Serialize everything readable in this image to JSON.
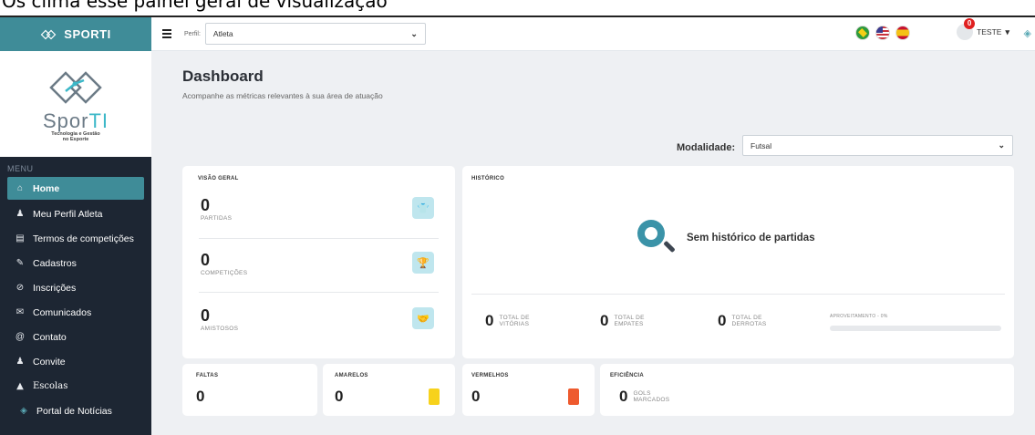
{
  "caption": "Os clima esse painel geral de visualização",
  "sidebar": {
    "brand": "SPORTI",
    "logo_name_a": "Spor",
    "logo_name_b": "TI",
    "logo_tagline_1": "Tecnologia e Gestão",
    "logo_tagline_2": "no Esporte",
    "menu_label": "MENU",
    "items": [
      {
        "label": "Home",
        "icon": "home-icon",
        "active": true
      },
      {
        "label": "Meu Perfil Atleta",
        "icon": "user-icon"
      },
      {
        "label": "Termos de competições",
        "icon": "document-icon"
      },
      {
        "label": "Cadastros",
        "icon": "edit-icon"
      },
      {
        "label": "Inscrições",
        "icon": "check-circle-icon"
      },
      {
        "label": "Comunicados",
        "icon": "envelope-icon"
      },
      {
        "label": "Contato",
        "icon": "at-icon"
      },
      {
        "label": "Convite",
        "icon": "users-icon"
      },
      {
        "label": "Escolas",
        "icon": "graduation-cap-icon"
      },
      {
        "label": "Portal de Notícias",
        "icon": "sporti-logo-icon"
      }
    ]
  },
  "topbar": {
    "perfil_label": "Perfil:",
    "perfil_value": "Atleta",
    "flags": [
      "brazil-flag-icon",
      "usa-flag-icon",
      "spain-flag-icon"
    ],
    "notification_count": "0",
    "user_name": "TESTE"
  },
  "header": {
    "title": "Dashboard",
    "subtitle": "Acompanhe as métricas relevantes à sua área de atuação",
    "modalidade_label": "Modalidade:",
    "modalidade_value": "Futsal"
  },
  "overview": {
    "title": "VISÃO GERAL",
    "metrics": [
      {
        "value": "0",
        "label": "PARTIDAS",
        "icon": "shirt-icon"
      },
      {
        "value": "0",
        "label": "COMPETIÇÕES",
        "icon": "trophy-icon"
      },
      {
        "value": "0",
        "label": "AMISTOSOS",
        "icon": "handshake-icon"
      }
    ]
  },
  "history": {
    "title": "HISTÓRICO",
    "empty_message": "Sem histórico de partidas",
    "totals": [
      {
        "value": "0",
        "label_1": "TOTAL DE",
        "label_2": "VITÓRIAS"
      },
      {
        "value": "0",
        "label_1": "TOTAL DE",
        "label_2": "EMPATES"
      },
      {
        "value": "0",
        "label_1": "TOTAL DE",
        "label_2": "DERROTAS"
      }
    ],
    "aproveitamento_label": "APROVEITAMENTO - 0%",
    "aproveitamento_percent": 0
  },
  "bottom": {
    "faltas_title": "FALTAS",
    "faltas_value": "0",
    "amarelos_title": "AMARELOS",
    "amarelos_value": "0",
    "vermelhos_title": "VERMELHOS",
    "vermelhos_value": "0",
    "eficiencia_title": "EFICIÊNCIA",
    "eficiencia_value": "0",
    "eficiencia_label_1": "GOLS",
    "eficiencia_label_2": "MARCADOS"
  },
  "colors": {
    "sidebar_bg": "#1d2633",
    "accent": "#3f8c98",
    "yellow_card": "#f7d21c",
    "red_card": "#ee5a2e"
  }
}
